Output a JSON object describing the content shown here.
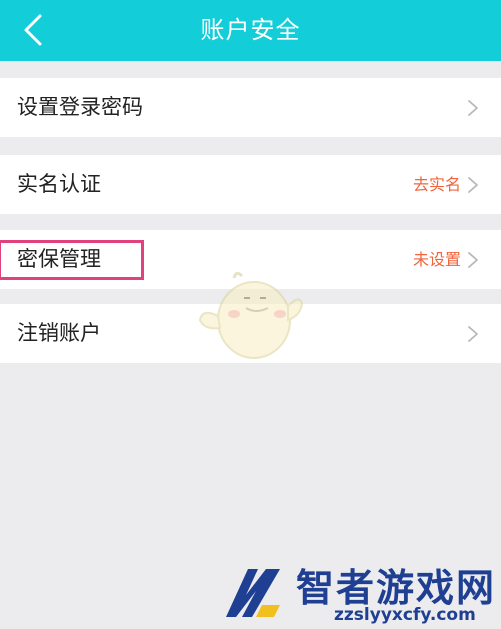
{
  "header": {
    "title": "账户安全",
    "back_icon": "chevron-left-icon",
    "background": "#13cdd9"
  },
  "rows": [
    {
      "label": "设置登录密码",
      "value": ""
    },
    {
      "label": "实名认证",
      "value": "去实名"
    },
    {
      "label": "密保管理",
      "value": "未设置"
    },
    {
      "label": "注销账户",
      "value": ""
    }
  ],
  "colors": {
    "accent_value": "#f0643c",
    "highlight_border": "#e0427d",
    "page_background": "#ececee"
  },
  "watermark": {
    "title": "智者游戏网",
    "domain": "zzslyyxcfy.com"
  }
}
